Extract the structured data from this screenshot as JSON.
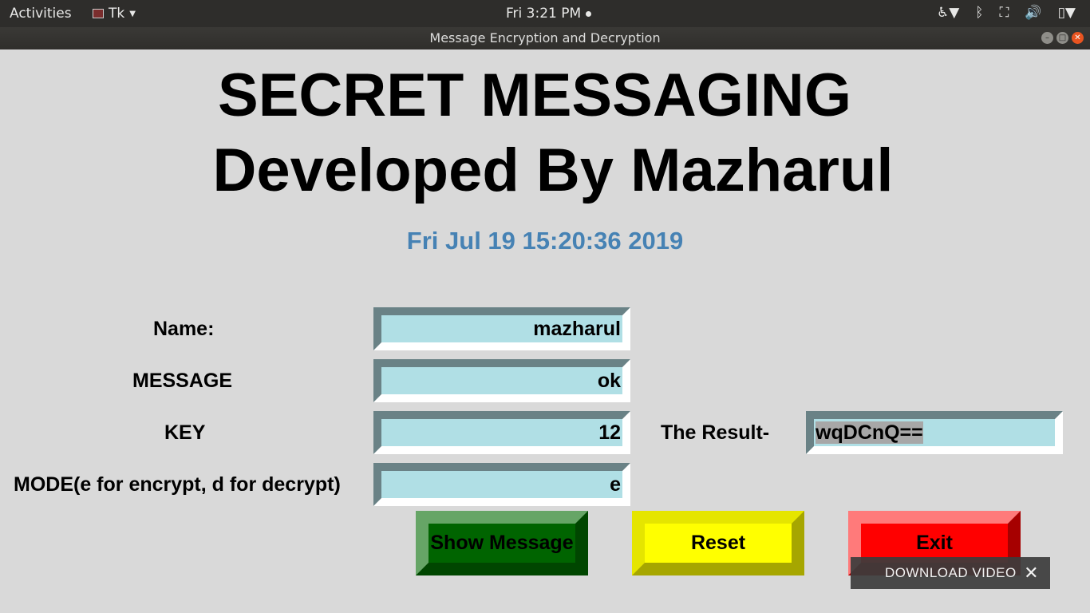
{
  "topbar": {
    "activities": "Activities",
    "app_name": "Tk",
    "clock": "Fri  3:21 PM",
    "tray_icons": [
      "accessibility-icon",
      "bluetooth-icon",
      "network-icon",
      "volume-icon",
      "battery-icon"
    ]
  },
  "window": {
    "title": "Message Encryption and Decryption"
  },
  "app": {
    "title_line1": "SECRET MESSAGING",
    "title_line2": "Developed By Mazharul",
    "datetime": "Fri Jul 19 15:20:36 2019",
    "fields": {
      "name_label": "Name:",
      "name_value": "mazharul",
      "message_label": "MESSAGE",
      "message_value": "ok",
      "key_label": "KEY",
      "key_value": "12",
      "mode_label": "MODE(e for encrypt, d for decrypt)",
      "mode_value": "e",
      "result_label": "The Result-",
      "result_value": "wqDCnQ=="
    },
    "buttons": {
      "show": "Show Message",
      "reset": "Reset",
      "exit": "Exit"
    }
  },
  "overlay": {
    "download_label": "DOWNLOAD VIDEO",
    "close_symbol": "✕"
  },
  "colors": {
    "datetime": "#4682b4",
    "entry_bg": "#b0dfe5",
    "show_button": "#006400",
    "reset_button": "#ffff00",
    "exit_button": "#ff0000"
  }
}
